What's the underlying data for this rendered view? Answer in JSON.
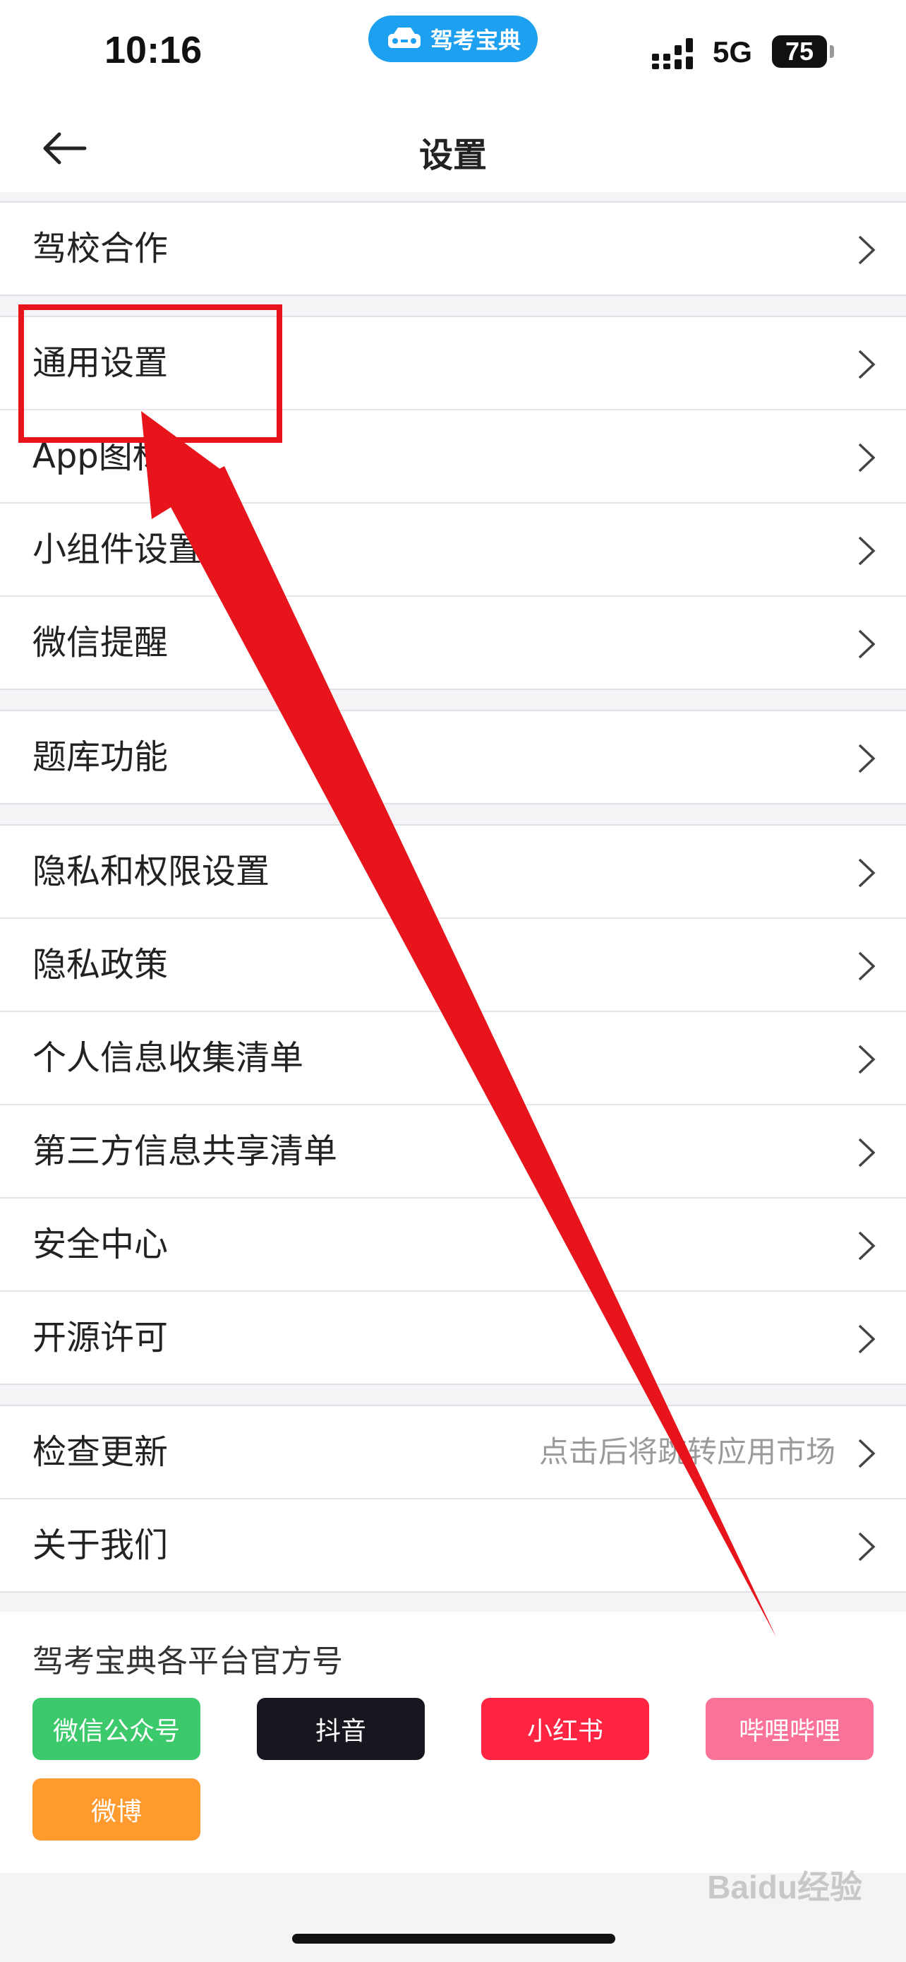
{
  "status_bar": {
    "time": "10:16",
    "app_pill": "驾考宝典",
    "network": "5G",
    "battery": "75"
  },
  "nav": {
    "title": "设置"
  },
  "groups": [
    {
      "items": [
        {
          "label": "驾校合作"
        }
      ]
    },
    {
      "items": [
        {
          "label": "通用设置"
        },
        {
          "label": "App图标"
        },
        {
          "label": "小组件设置"
        },
        {
          "label": "微信提醒"
        }
      ]
    },
    {
      "items": [
        {
          "label": "题库功能"
        }
      ]
    },
    {
      "items": [
        {
          "label": "隐私和权限设置"
        },
        {
          "label": "隐私政策"
        },
        {
          "label": "个人信息收集清单"
        },
        {
          "label": "第三方信息共享清单"
        },
        {
          "label": "安全中心"
        },
        {
          "label": "开源许可"
        }
      ]
    },
    {
      "items": [
        {
          "label": "检查更新",
          "hint": "点击后将跳转应用市场"
        },
        {
          "label": "关于我们"
        }
      ]
    }
  ],
  "official_accounts": {
    "title": "驾考宝典各平台官方号",
    "buttons": [
      {
        "label": "微信公众号",
        "color": "#3cc96b"
      },
      {
        "label": "抖音",
        "color": "#16171f"
      },
      {
        "label": "小红书",
        "color": "#ff2442"
      },
      {
        "label": "哔哩哔哩",
        "color": "#fb7299"
      },
      {
        "label": "微博",
        "color": "#ff9a2e"
      }
    ]
  },
  "watermark": "Baidu经验",
  "annotation": {
    "color": "#e8141c"
  }
}
